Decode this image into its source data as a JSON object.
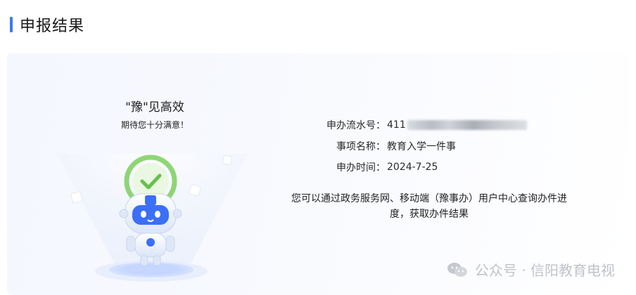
{
  "header": {
    "title": "申报结果"
  },
  "slogan": {
    "line1": "\"豫\"见高效",
    "line2": "期待您十分满意！"
  },
  "info": {
    "serial_label": "申办流水号：",
    "serial_value": "411",
    "item_label": "事项名称：",
    "item_value": "教育入学一件事",
    "time_label": "申办时间：",
    "time_value": "2024-7-25"
  },
  "note": {
    "line1": "您可以通过政务服务网、移动端（豫事办）用户中心查询办件进",
    "line2": "度，获取办件结果"
  },
  "watermark": {
    "text": "公众号 · 信阳教育电视"
  },
  "colors": {
    "accent": "#3a7bf0",
    "check_green": "#66c24b",
    "robot_blue": "#3b6ff5"
  },
  "icons": {
    "mascot": "robot-mascot-icon",
    "check": "check-icon",
    "watermark": "wechat-icon"
  }
}
